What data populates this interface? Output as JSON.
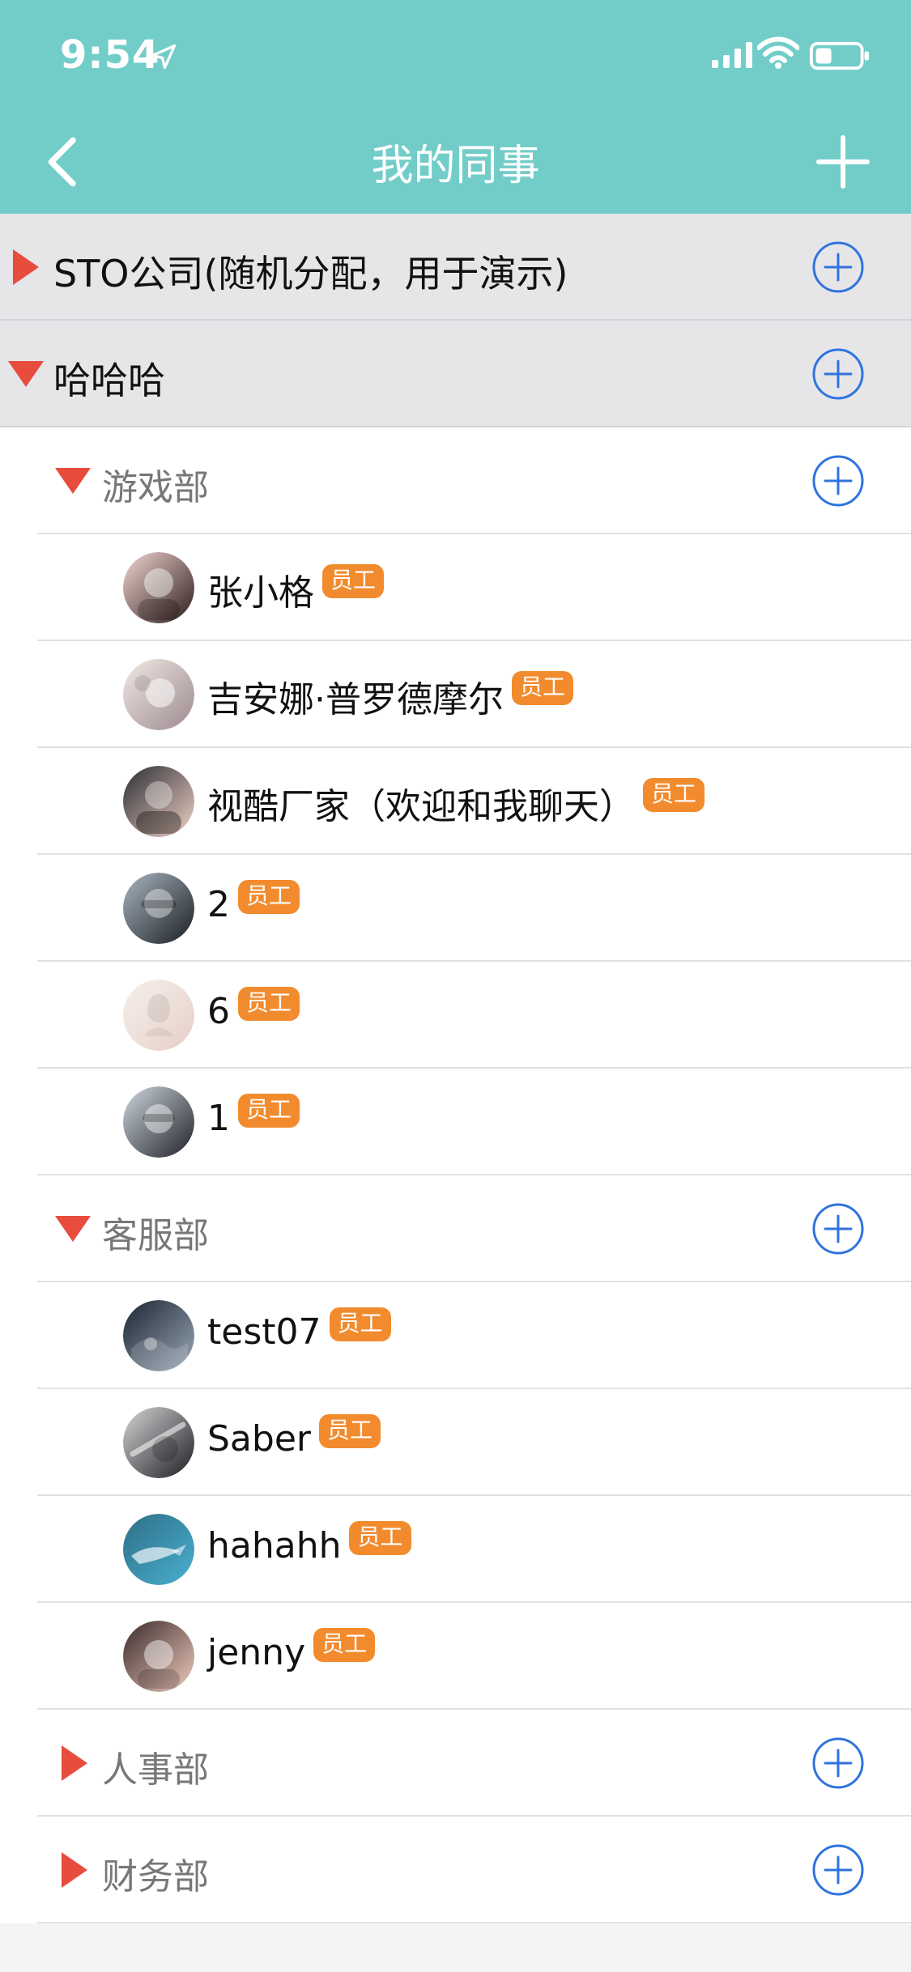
{
  "status": {
    "time": "9:54"
  },
  "nav": {
    "title": "我的同事"
  },
  "badge": {
    "employee": "员工"
  },
  "orgs": [
    {
      "name": "STO公司(随机分配，用于演示)",
      "expanded": false
    },
    {
      "name": "哈哈哈",
      "expanded": true
    }
  ],
  "departments": [
    {
      "name": "游戏部",
      "expanded": true,
      "members": [
        {
          "name": "张小格",
          "avatar_colors": [
            "#f4d7d2",
            "#2b1b1a"
          ]
        },
        {
          "name": "吉安娜·普罗德摩尔",
          "avatar_colors": [
            "#f2e9e4",
            "#9c8a90"
          ]
        },
        {
          "name": "视酷厂家（欢迎和我聊天）",
          "avatar_colors": [
            "#2a2b33",
            "#f1d3c5"
          ]
        },
        {
          "name": "2",
          "avatar_colors": [
            "#a9b6c2",
            "#1b1e23"
          ]
        },
        {
          "name": "6",
          "avatar_colors": [
            "#f7f0ec",
            "#e5cfc6"
          ]
        },
        {
          "name": "1",
          "avatar_colors": [
            "#cfd7df",
            "#1f2126"
          ]
        }
      ]
    },
    {
      "name": "客服部",
      "expanded": true,
      "members": [
        {
          "name": "test07",
          "avatar_colors": [
            "#1b2534",
            "#9aa8b6"
          ]
        },
        {
          "name": "Saber",
          "avatar_colors": [
            "#d6d6d8",
            "#1d1e22"
          ]
        },
        {
          "name": "hahahh",
          "avatar_colors": [
            "#2e6e86",
            "#4ab0d1"
          ]
        },
        {
          "name": "jenny",
          "avatar_colors": [
            "#3a2a2b",
            "#f0cbbd"
          ]
        }
      ]
    },
    {
      "name": "人事部",
      "expanded": false,
      "members": []
    },
    {
      "name": "财务部",
      "expanded": false,
      "members": []
    }
  ],
  "colors": {
    "header": "#72cdc9",
    "triangle": "#e84c3d",
    "plus": "#2f73e0",
    "badge": "#f28b2e"
  }
}
